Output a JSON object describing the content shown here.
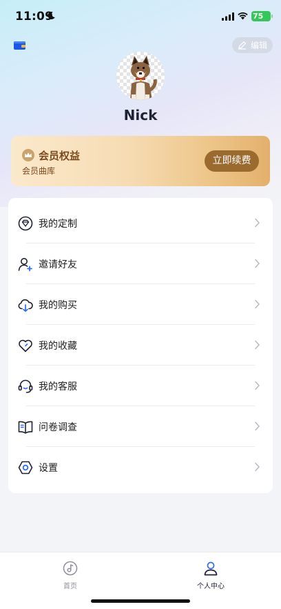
{
  "status_bar": {
    "time": "11:09",
    "battery": "75"
  },
  "header": {
    "edit_label": "编辑",
    "username": "Nick"
  },
  "vip": {
    "title": "会员权益",
    "subtitle": "会员曲库",
    "renew_label": "立即续费"
  },
  "menu": {
    "items": [
      {
        "label": "我的定制",
        "icon": "diamond-icon"
      },
      {
        "label": "邀请好友",
        "icon": "user-add-icon"
      },
      {
        "label": "我的购买",
        "icon": "cloud-download-icon"
      },
      {
        "label": "我的收藏",
        "icon": "heart-icon"
      },
      {
        "label": "我的客服",
        "icon": "headset-icon"
      },
      {
        "label": "问卷调查",
        "icon": "book-icon"
      },
      {
        "label": "设置",
        "icon": "settings-hexagon-icon"
      }
    ]
  },
  "tabbar": {
    "tabs": [
      {
        "label": "首页",
        "icon": "music-disc-icon",
        "active": false
      },
      {
        "label": "个人中心",
        "icon": "person-icon",
        "active": true
      }
    ]
  },
  "colors": {
    "accent_blue": "#2d6df6",
    "vip_text": "#7a4a1f",
    "renew_button": "#9b6a2f",
    "battery_green": "#34c759"
  }
}
